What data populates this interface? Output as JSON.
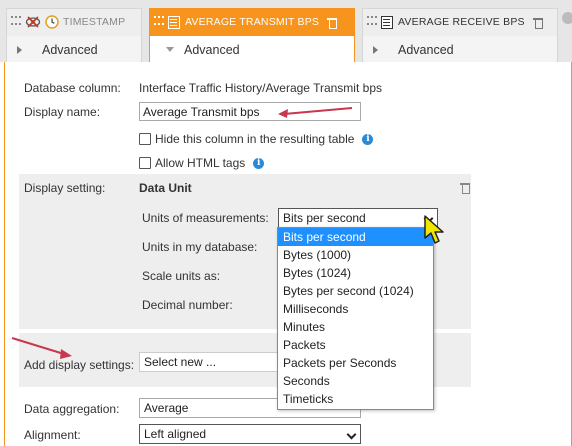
{
  "tabs": [
    {
      "title": "TIMESTAMP",
      "advanced": "Advanced",
      "active": false
    },
    {
      "title": "AVERAGE TRANSMIT BPS",
      "advanced": "Advanced",
      "active": true
    },
    {
      "title": "AVERAGE RECEIVE BPS",
      "advanced": "Advanced",
      "active": false
    }
  ],
  "form": {
    "database_column_label": "Database column:",
    "database_column_value": "Interface Traffic History/Average Transmit bps",
    "display_name_label": "Display name:",
    "display_name_value": "Average Transmit bps",
    "hide_column_label": "Hide this column in the resulting table",
    "allow_html_label": "Allow HTML tags",
    "display_setting_label": "Display setting:",
    "display_setting_name": "Data Unit",
    "units_measure_label": "Units of measurements:",
    "units_measure_value": "Bits per second",
    "units_db_label": "Units in my database:",
    "scale_label": "Scale units as:",
    "decimal_label": "Decimal number:",
    "add_display_label": "Add display settings:",
    "add_display_value": "Select new ...",
    "aggregation_label": "Data aggregation:",
    "aggregation_value": "Average",
    "alignment_label": "Alignment:",
    "alignment_value": "Left aligned"
  },
  "dropdown": {
    "options": [
      "Bits per second",
      "Bytes (1000)",
      "Bytes (1024)",
      "Bytes per second (1024)",
      "Milliseconds",
      "Minutes",
      "Packets",
      "Packets per Seconds",
      "Seconds",
      "Timeticks"
    ],
    "selected_index": 0
  },
  "colors": {
    "accent": "#f7941d",
    "selection": "#1e90ff",
    "info": "#2b8ad6",
    "annotation_arrow": "#c8374f"
  }
}
